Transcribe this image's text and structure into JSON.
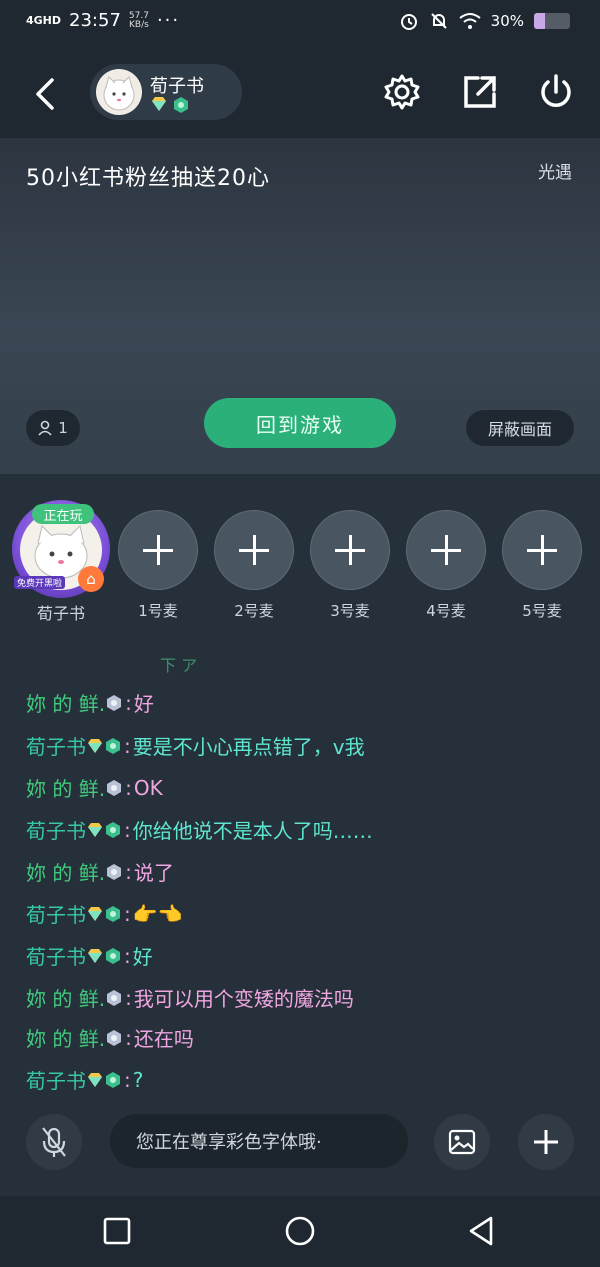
{
  "status": {
    "network": "4GHD",
    "time": "23:57",
    "speed": "57.7",
    "speed_unit": "KB/s",
    "more": "···",
    "battery": "30%"
  },
  "header": {
    "username": "荀子书"
  },
  "video": {
    "title": "50小红书粉丝抽送20心",
    "tag": "光遇",
    "viewer_count": "1",
    "back_to_game": "回到游戏",
    "block_screen": "屏蔽画面"
  },
  "seats": {
    "host": {
      "name": "荀子书",
      "playing": "正在玩",
      "live_text": "免费开黑啦"
    },
    "mics": [
      "1号麦",
      "2号麦",
      "3号麦",
      "4号麦",
      "5号麦"
    ]
  },
  "chat": {
    "scroll_hint": "下 ア",
    "messages": [
      {
        "user": "妳 的 鲜.",
        "text": "好"
      },
      {
        "user": "荀子书",
        "text": "要是不小心再点错了，v我"
      },
      {
        "user": "妳 的 鲜.",
        "text": "OK"
      },
      {
        "user": "荀子书",
        "text": "你给他说不是本人了吗……"
      },
      {
        "user": "妳 的 鲜.",
        "text": "说了"
      },
      {
        "user": "荀子书",
        "text": "👉👈"
      },
      {
        "user": "荀子书",
        "text": "好"
      },
      {
        "user": "妳 的 鲜.",
        "text": "我可以用个变矮的魔法吗"
      },
      {
        "user": "妳 的 鲜.",
        "text": "还在吗"
      },
      {
        "user": "荀子书",
        "text": "?"
      }
    ]
  },
  "composer": {
    "placeholder": "您正在尊享彩色字体哦·"
  }
}
